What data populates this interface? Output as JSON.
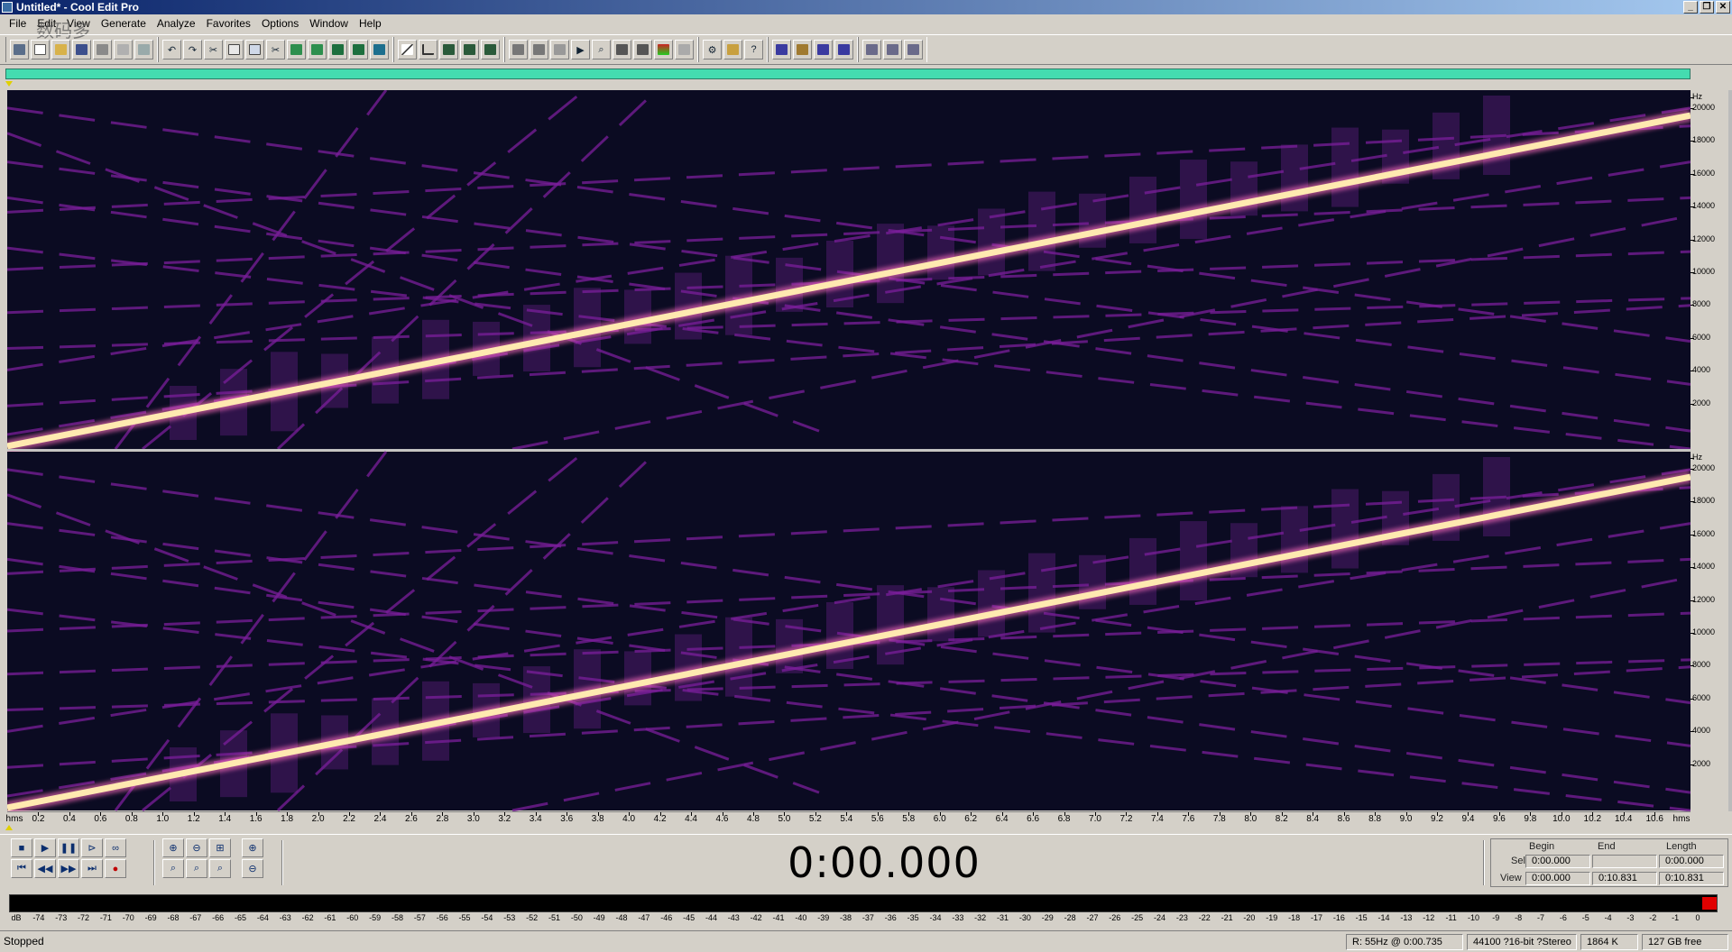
{
  "window": {
    "title": "Untitled* - Cool Edit Pro",
    "controls": [
      "_",
      "❐",
      "✕"
    ]
  },
  "menu": [
    "File",
    "Edit",
    "View",
    "Generate",
    "Analyze",
    "Favorites",
    "Options",
    "Window",
    "Help"
  ],
  "watermark": "数码多",
  "spectral_scale": {
    "unit_label": "Hz",
    "ticks": [
      "20000",
      "18000",
      "16000",
      "14000",
      "12000",
      "10000",
      "8000",
      "6000",
      "4000",
      "2000"
    ]
  },
  "ruler": {
    "start_label": "hms",
    "end_label": "hms",
    "labels": [
      "0.2",
      "0.4",
      "0.6",
      "0.8",
      "1.0",
      "1.2",
      "1.4",
      "1.6",
      "1.8",
      "2.0",
      "2.2",
      "2.4",
      "2.6",
      "2.8",
      "3.0",
      "3.2",
      "3.4",
      "3.6",
      "3.8",
      "4.0",
      "4.2",
      "4.4",
      "4.6",
      "4.8",
      "5.0",
      "5.2",
      "5.4",
      "5.6",
      "5.8",
      "6.0",
      "6.2",
      "6.4",
      "6.6",
      "6.8",
      "7.0",
      "7.2",
      "7.4",
      "7.6",
      "7.8",
      "8.0",
      "8.2",
      "8.4",
      "8.6",
      "8.8",
      "9.0",
      "9.2",
      "9.4",
      "9.6",
      "9.8",
      "10.0",
      "10.2",
      "10.4",
      "10.6"
    ]
  },
  "time_display": "0:00.000",
  "selection": {
    "headers": {
      "begin": "Begin",
      "end": "End",
      "length": "Length"
    },
    "sel": {
      "label": "Sel",
      "begin": "0:00.000",
      "end": "",
      "length": "0:00.000"
    },
    "view": {
      "label": "View",
      "begin": "0:00.000",
      "end": "0:10.831",
      "length": "0:10.831"
    }
  },
  "meter": {
    "labels": [
      "dB",
      "-74",
      "-73",
      "-72",
      "-71",
      "-70",
      "-69",
      "-68",
      "-67",
      "-66",
      "-65",
      "-64",
      "-63",
      "-62",
      "-61",
      "-60",
      "-59",
      "-58",
      "-57",
      "-56",
      "-55",
      "-54",
      "-53",
      "-52",
      "-51",
      "-50",
      "-49",
      "-48",
      "-47",
      "-46",
      "-45",
      "-44",
      "-43",
      "-42",
      "-41",
      "-40",
      "-39",
      "-38",
      "-37",
      "-36",
      "-35",
      "-34",
      "-33",
      "-32",
      "-31",
      "-30",
      "-29",
      "-28",
      "-27",
      "-26",
      "-25",
      "-24",
      "-23",
      "-22",
      "-21",
      "-20",
      "-19",
      "-18",
      "-17",
      "-16",
      "-15",
      "-14",
      "-13",
      "-12",
      "-11",
      "-10",
      "-9",
      "-8",
      "-7",
      "-6",
      "-5",
      "-4",
      "-3",
      "-2",
      "-1",
      "0"
    ]
  },
  "status": {
    "state": "Stopped",
    "cursor": "R: 55Hz @   0:00.735",
    "format": "44100 ?16-bit ?Stereo",
    "size": "1864 K",
    "free": "127 GB free"
  },
  "colors": {
    "overview": "#44dcb0",
    "spectro_bg": "#0b0b22",
    "sweep": "#ffe9b0",
    "harmonics": "#7a1e9a",
    "titlebar": "#0a246a"
  }
}
